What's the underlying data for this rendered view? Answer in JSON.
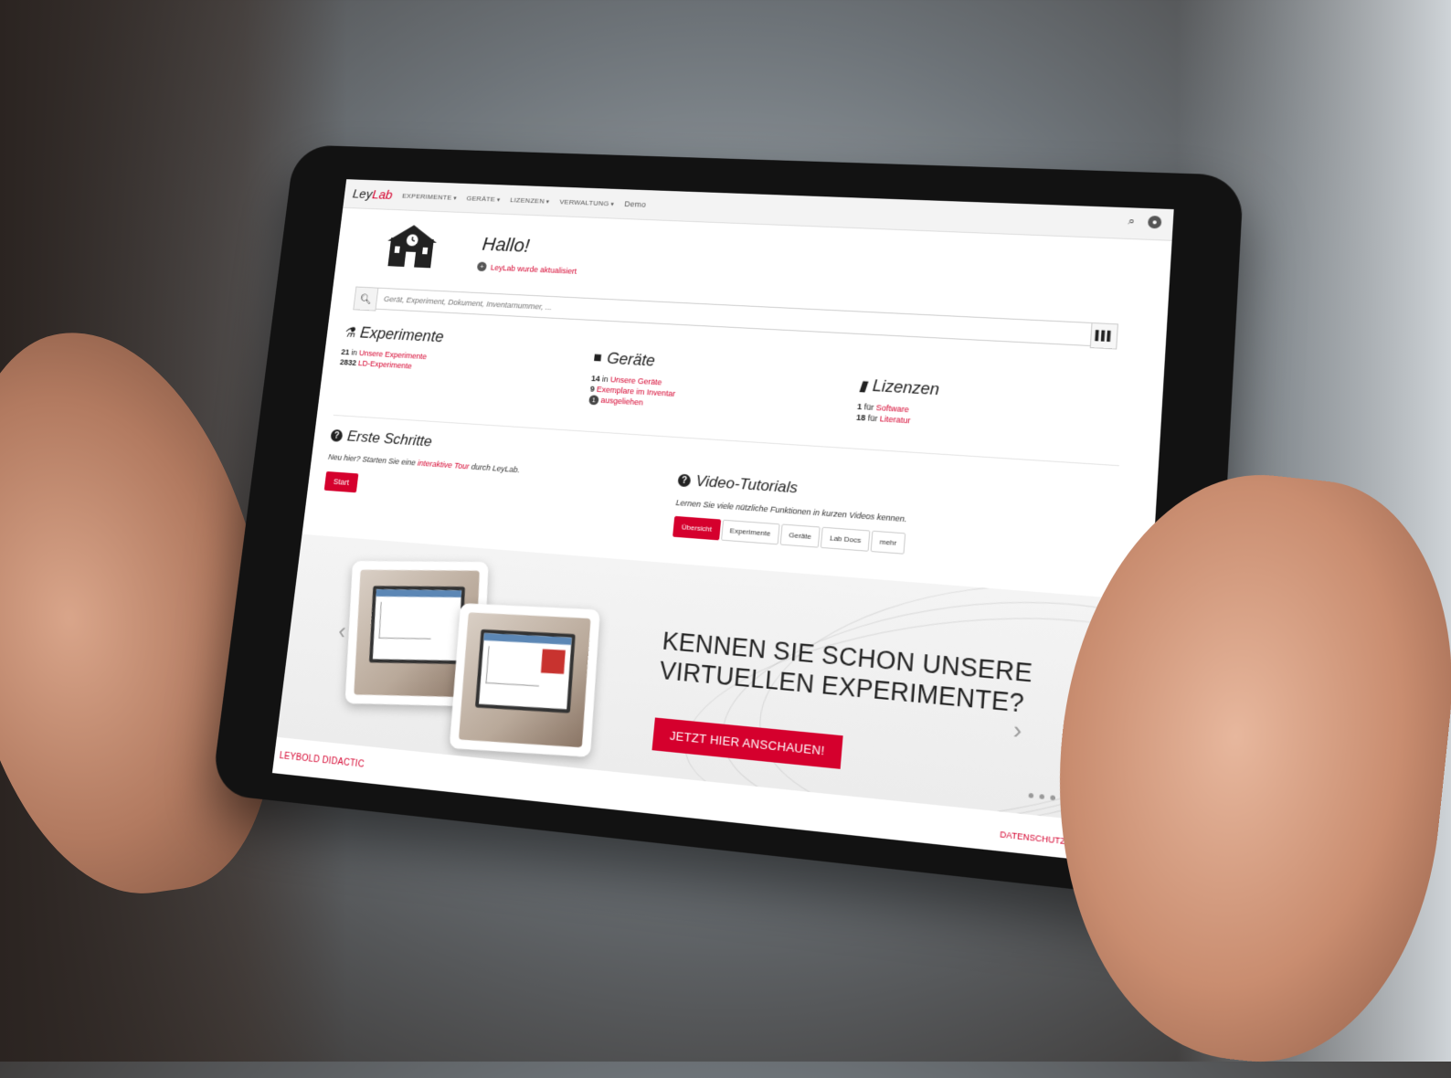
{
  "nav": {
    "brand_part1": "Ley",
    "brand_part2": "Lab",
    "items": [
      "EXPERIMENTE",
      "GERÄTE",
      "LIZENZEN",
      "VERWALTUNG",
      "Demo"
    ]
  },
  "header": {
    "greeting": "Hallo!",
    "update_text": "LeyLab wurde aktualisiert"
  },
  "search": {
    "placeholder": "Gerät, Experiment, Dokument, Inventarnummer, ..."
  },
  "experimente": {
    "title": "Experimente",
    "line1_num": "21",
    "line1_pre": "in",
    "line1_link": "Unsere Experimente",
    "line2_num": "2832",
    "line2_link": "LD-Experimente"
  },
  "geraete": {
    "title": "Geräte",
    "line1_num": "14",
    "line1_pre": "in",
    "line1_link": "Unsere Geräte",
    "line2_num": "9",
    "line2_link": "Exemplare im Inventar",
    "line3_badge": "1",
    "line3_link": "ausgeliehen"
  },
  "lizenzen": {
    "title": "Lizenzen",
    "line1_num": "1",
    "line1_pre": "für",
    "line1_link": "Software",
    "line2_num": "18",
    "line2_pre": "für",
    "line2_link": "Literatur"
  },
  "erste_schritte": {
    "title": "Erste Schritte",
    "text_pre": "Neu hier? Starten Sie eine",
    "text_link": "interaktive Tour",
    "text_post": "durch LeyLab.",
    "button": "Start"
  },
  "video_tutorials": {
    "title": "Video-Tutorials",
    "text": "Lernen Sie viele nützliche Funktionen in kurzen Videos kennen.",
    "buttons": [
      "Übersicht",
      "Experimente",
      "Geräte",
      "Lab Docs",
      "mehr"
    ]
  },
  "banner": {
    "headline_line1": "KENNEN SIE SCHON UNSERE",
    "headline_line2": "VIRTUELLEN EXPERIMENTE?",
    "cta": "JETZT HIER ANSCHAUEN!"
  },
  "footer": {
    "brand": "LEYBOLD DIDACTIC",
    "links": "DATENSCHUTZ | IMPRESSUM"
  },
  "colors": {
    "accent": "#d5002d"
  }
}
